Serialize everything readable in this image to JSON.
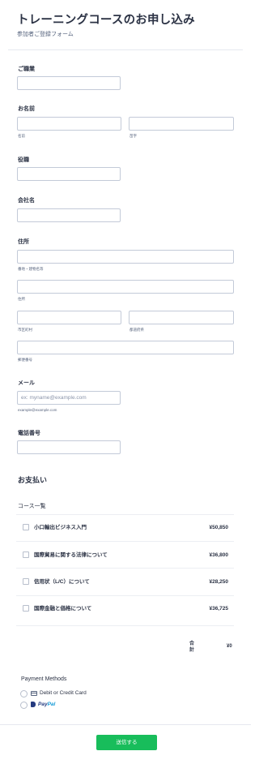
{
  "header": {
    "title": "トレーニングコースのお申し込み",
    "subtitle": "参加者ご登録フォーム"
  },
  "fields": {
    "salutation": {
      "label": "ご職業",
      "value": ""
    },
    "name": {
      "label": "お名前",
      "first_sub": "名前",
      "last_sub": "苗字"
    },
    "position": {
      "label": "役職"
    },
    "company": {
      "label": "会社名"
    },
    "address": {
      "label": "住所",
      "street1_sub": "番地・建物名等",
      "street2_sub": "住所",
      "city_sub": "市区町村",
      "state_sub": "都道府県",
      "zip_sub": "郵便番号"
    },
    "email": {
      "label": "メール",
      "placeholder": "ex: myname@example.com",
      "sub": "example@example.com"
    },
    "phone": {
      "label": "電話番号"
    }
  },
  "payment": {
    "title": "お支払い",
    "course_list_label": "コース一覧",
    "products": [
      {
        "name": "小口輸出ビジネス入門",
        "price": "¥50,850",
        "checked": false
      },
      {
        "name": "国際貿易に関する法律について",
        "price": "¥36,800",
        "checked": false
      },
      {
        "name": "信用状（L/C）について",
        "price": "¥28,250",
        "checked": false
      },
      {
        "name": "国際金融と価格について",
        "price": "¥36,725",
        "checked": false
      }
    ],
    "total_label": "合計",
    "total_value": "¥0",
    "methods_label": "Payment Methods",
    "methods": [
      {
        "label": "Debit or Credit Card",
        "icon": "credit-card-icon"
      },
      {
        "label_a": "Pay",
        "label_b": "Pal",
        "icon": "paypal-icon"
      }
    ]
  },
  "submit": {
    "label": "送信する"
  },
  "colors": {
    "accent": "#18bd5b",
    "text": "#2c3345",
    "border": "#c3cad8"
  }
}
